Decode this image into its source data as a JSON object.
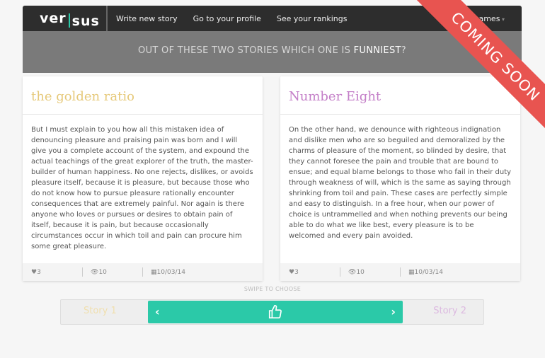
{
  "nav": {
    "logo": "versus",
    "logo_left": "ver",
    "logo_right": "sus",
    "links": [
      "Write new story",
      "Go to your profile",
      "See your rankings"
    ],
    "right": "ing games"
  },
  "hero": {
    "prefix": "OUT OF THESE TWO STORIES WHICH ONE IS ",
    "highlight": "FUNNIEST",
    "suffix": "?"
  },
  "stories": [
    {
      "title": "the golden ratio",
      "color": "#e6c97a",
      "body": "But I must explain to you how all this mistaken idea of denouncing pleasure and praising pain was born and I will give you a complete account of the system, and expound the actual teachings of the great explorer of the truth, the master-builder of human happiness. No one rejects, dislikes, or avoids pleasure itself, because it is pleasure, but because those who do not know how to pursue pleasure rationally encounter consequences that are extremely painful. Nor again is there anyone who loves or pursues or desires to obtain pain of itself, because it is pain, but because occasionally circumstances occur in which toil and pain can procure him some great pleasure.",
      "likes": "3",
      "views": "10",
      "date": "10/03/14"
    },
    {
      "title": "Number Eight",
      "color": "#c47fc8",
      "body": "On the other hand, we denounce with righteous indignation and dislike men who are so beguiled and demoralized by the charms of pleasure of the moment, so blinded by desire, that they cannot foresee the pain and trouble that are bound to ensue; and equal blame belongs to those who fail in their duty through weakness of will, which is the same as saying through shrinking from toil and pain. These cases are perfectly simple and easy to distinguish. In a free hour, when our power of choice is untrammelled and when nothing prevents our being able to do what we like best, every pleasure is to be welcomed and every pain avoided.",
      "likes": "3",
      "views": "10",
      "date": "10/03/14"
    }
  ],
  "swipe_label": "SWIPE TO CHOOSE",
  "slider": {
    "left": "Story 1",
    "right": "Story 2",
    "accent": "#2bc9a8"
  },
  "ribbon": "COMING SOON"
}
